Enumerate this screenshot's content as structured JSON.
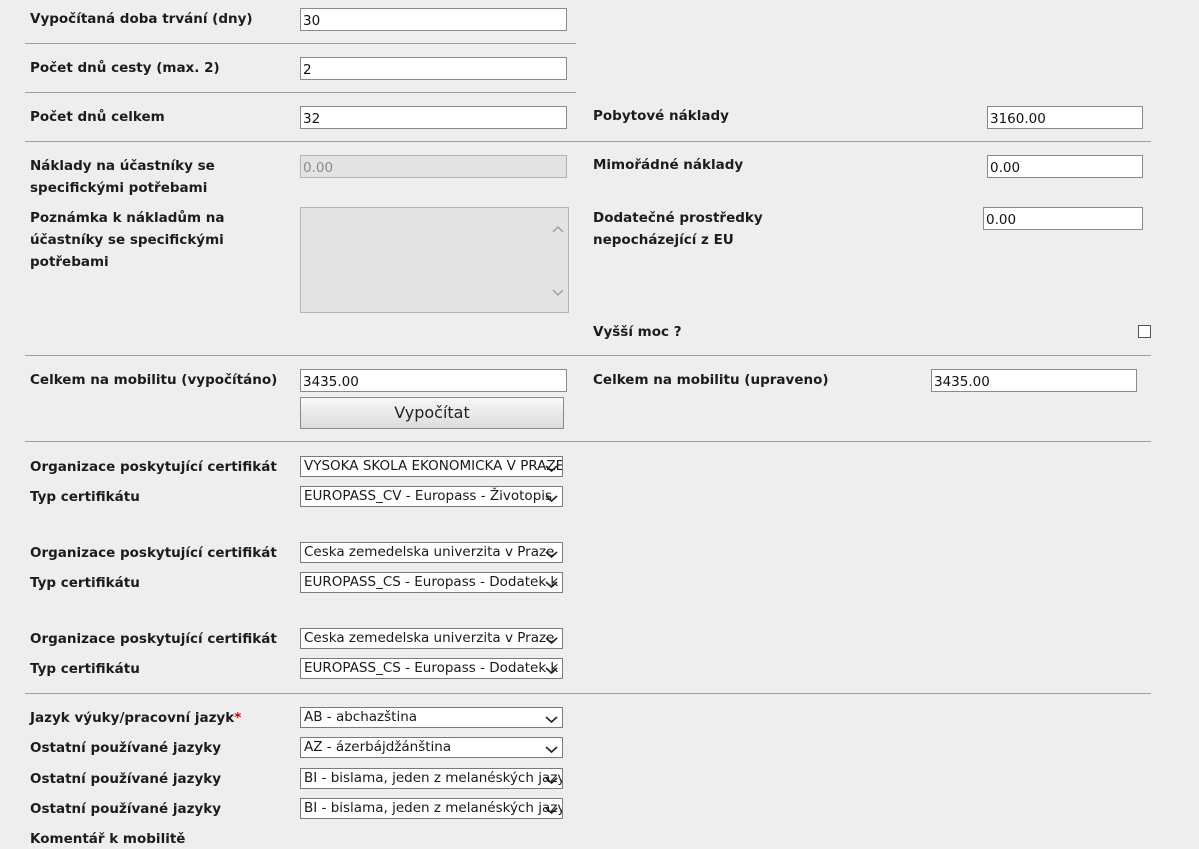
{
  "duration": {
    "label": "Vypočítaná doba trvání (dny)",
    "value": "30"
  },
  "travel_days": {
    "label": "Počet dnů cesty (max. 2)",
    "value": "2"
  },
  "total_days": {
    "label": "Počet dnů celkem",
    "value": "32"
  },
  "stay_costs": {
    "label": "Pobytové náklady",
    "value": "3160.00"
  },
  "special_needs_costs": {
    "label": "Náklady na účastníky se specifickými potřebami",
    "value": "0.00"
  },
  "extraordinary_costs": {
    "label": "Mimořádné náklady",
    "value": "0.00"
  },
  "special_needs_note": {
    "label": "Poznámka k nákladům na účastníky se specifickými potřebami",
    "value": ""
  },
  "non_eu_funds": {
    "label": "Dodatečné prostředky nepocházející z EU",
    "value": "0.00"
  },
  "force_majeure": {
    "label": "Vyšší moc ?",
    "checked": false
  },
  "total_calculated": {
    "label": "Celkem na mobilitu (vypočítáno)",
    "value": "3435.00"
  },
  "total_adjusted": {
    "label": "Celkem na mobilitu (upraveno)",
    "value": "3435.00"
  },
  "calculate_button": "Vypočítat",
  "certificates": [
    {
      "org_label": "Organizace poskytující certifikát",
      "org_value": "VYSOKA SKOLA EKONOMICKA V PRAZE",
      "type_label": "Typ certifikátu",
      "type_value": "EUROPASS_CV - Europass - Životopis"
    },
    {
      "org_label": "Organizace poskytující certifikát",
      "org_value": "Ceska zemedelska univerzita v Praze",
      "type_label": "Typ certifikátu",
      "type_value": "EUROPASS_CS - Europass - Dodatek k osvědčení"
    },
    {
      "org_label": "Organizace poskytující certifikát",
      "org_value": "Ceska zemedelska univerzita v Praze",
      "type_label": "Typ certifikátu",
      "type_value": "EUROPASS_CS - Europass - Dodatek k osvědčení"
    }
  ],
  "languages": {
    "main_label": "Jazyk výuky/pracovní jazyk",
    "required_mark": "*",
    "main_value": "AB - abchazština",
    "other_label": "Ostatní používané jazyky",
    "other_values": [
      "AZ - ázerbájdžánština",
      "BI - bislama, jeden z melanéských jazyků",
      "BI - bislama, jeden z melanéských jazyků"
    ]
  },
  "comment_label": "Komentář k mobilitě"
}
